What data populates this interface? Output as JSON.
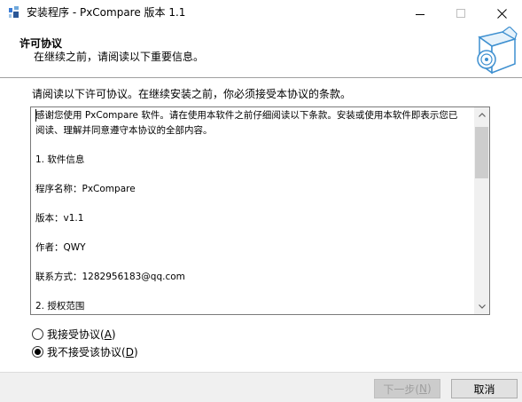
{
  "window": {
    "title": "安装程序 - PxCompare 版本 1.1",
    "minimize_icon": "minimize-icon",
    "maximize_icon": "maximize-icon",
    "close_icon": "close-icon"
  },
  "header": {
    "title": "许可协议",
    "subtitle": "在继续之前，请阅读以下重要信息。",
    "logo_icon": "installer-box-cd-icon"
  },
  "main": {
    "prompt": "请阅读以下许可协议。在继续安装之前，你必须接受本协议的条款。",
    "license_lines": [
      "感谢您使用 PxCompare 软件。请在使用本软件之前仔细阅读以下条款。安装或使用本软件即表示您已",
      "阅读、理解并同意遵守本协议的全部内容。",
      "1. 软件信息",
      "程序名称：PxCompare",
      "版本：v1.1",
      "作者：QWY",
      "联系方式：1282956183@qq.com",
      "2. 授权范围"
    ],
    "scroll_up_icon": "scroll-up-arrow-icon",
    "scroll_down_icon": "scroll-down-arrow-icon"
  },
  "options": {
    "accept_label": "我接受协议(",
    "accept_key": "A",
    "accept_close": ")",
    "decline_label": "我不接受该协议(",
    "decline_key": "D",
    "decline_close": ")",
    "selected": "decline"
  },
  "footer": {
    "next_label": "下一步(",
    "next_key": "N",
    "next_close": ")",
    "cancel_label": "取消"
  }
}
